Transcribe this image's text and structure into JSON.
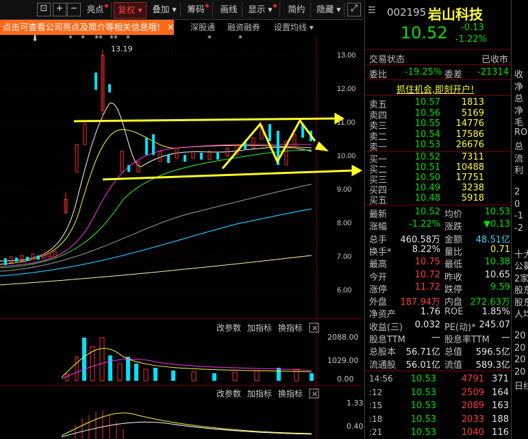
{
  "toolbar": {
    "buttons": [
      "亮点",
      "复权",
      "叠加",
      "筹码",
      "画线",
      "显示",
      "简约",
      "隐藏"
    ],
    "active": "复权"
  },
  "promo": {
    "text": "点击可查看公司亮点及简介等相关信息哦!",
    "close": "✕"
  },
  "sub_links": [
    "深股通",
    "融资融券",
    "设置均线"
  ],
  "chart": {
    "price_axis": [
      "13.00",
      "12.00",
      "11.00",
      "10.00",
      "9.00",
      "8.00",
      "7.00",
      "6.00"
    ],
    "high_label": "13.19",
    "vol_axis": [
      "2088.00",
      "1029.00",
      "0.00"
    ],
    "macd_axis": [
      "1.33",
      "0.40"
    ],
    "panel_buttons": [
      "改参数",
      "加指标",
      "换指标"
    ]
  },
  "stock": {
    "code": "002195",
    "name": "岩山科技",
    "price": "10.52",
    "change": "-0.13",
    "change_pct": "-1.22%"
  },
  "status": {
    "label": "交易状态",
    "value": "已收市"
  },
  "weibi": {
    "label1": "委比",
    "value1": "-19.25%",
    "label2": "委差",
    "value2": "-21314"
  },
  "promo_link": "抓住机会,即刻开户!",
  "sell": [
    {
      "label": "卖五",
      "price": "10.57",
      "vol": "1813"
    },
    {
      "label": "卖四",
      "price": "10.56",
      "vol": "5169"
    },
    {
      "label": "卖三",
      "price": "10.55",
      "vol": "14776"
    },
    {
      "label": "卖二",
      "price": "10.54",
      "vol": "17586"
    },
    {
      "label": "卖一",
      "price": "10.53",
      "vol": "26676"
    }
  ],
  "buy": [
    {
      "label": "买一",
      "price": "10.52",
      "vol": "7311"
    },
    {
      "label": "买二",
      "price": "10.51",
      "vol": "10488"
    },
    {
      "label": "买三",
      "price": "10.50",
      "vol": "17751"
    },
    {
      "label": "买四",
      "price": "10.49",
      "vol": "3238"
    },
    {
      "label": "买五",
      "price": "10.48",
      "vol": "5918"
    }
  ],
  "stats": [
    {
      "l1": "最新",
      "v1": "10.52",
      "c1": "green",
      "l2": "均价",
      "v2": "10.53",
      "c2": "green"
    },
    {
      "l1": "涨幅",
      "v1": "-1.22%",
      "c1": "green",
      "l2": "涨跌",
      "v2": "▼0.13",
      "c2": "green"
    },
    {
      "l1": "总手",
      "v1": "460.58万",
      "c1": "white",
      "l2": "金额",
      "v2": "48.51亿",
      "c2": "cyan"
    },
    {
      "l1": "换手*",
      "v1": "8.22%",
      "c1": "white",
      "l2": "量比",
      "v2": "0.71",
      "c2": "yellow"
    },
    {
      "l1": "最高",
      "v1": "10.75",
      "c1": "red",
      "l2": "最低",
      "v2": "10.38",
      "c2": "green"
    },
    {
      "l1": "今开",
      "v1": "10.72",
      "c1": "red",
      "l2": "昨收",
      "v2": "10.65",
      "c2": "white"
    },
    {
      "l1": "涨停",
      "v1": "11.72",
      "c1": "red",
      "l2": "跌停",
      "v2": "9.59",
      "c2": "green"
    },
    {
      "l1": "外盘",
      "v1": "187.94万",
      "c1": "red",
      "l2": "内盘",
      "v2": "272.63万",
      "c2": "green"
    },
    {
      "l1": "净资产",
      "v1": "1.76",
      "c1": "white",
      "l2": "ROE",
      "v2": "1.85%",
      "c2": "white"
    },
    {
      "l1": "收益(三)",
      "v1": "0.032",
      "c1": "white",
      "l2": "PE(动)*",
      "v2": "245.07",
      "c2": "white"
    },
    {
      "l1": "股息TTM",
      "v1": "—",
      "c1": "white",
      "l2": "股息率TTM",
      "v2": "—",
      "c2": "white"
    },
    {
      "l1": "总股本",
      "v1": "56.71亿",
      "c1": "white",
      "l2": "总值",
      "v2": "596.5亿",
      "c2": "white"
    },
    {
      "l1": "流通股",
      "v1": "56.01亿",
      "c1": "white",
      "l2": "流值",
      "v2": "589.3亿",
      "c2": "white"
    }
  ],
  "ticks": [
    {
      "time": "14:56",
      "price": "10.53",
      "vol": "4791",
      "n": "371"
    },
    {
      "time": ":12",
      "price": "10.53",
      "vol": "2509",
      "n": "164"
    },
    {
      "time": ":15",
      "price": "10.53",
      "vol": "2089",
      "n": "163"
    },
    {
      "time": ":18",
      "price": "10.53",
      "vol": "2033",
      "n": "188"
    },
    {
      "time": ":21",
      "price": "10.53",
      "vol": "1040",
      "n": "116"
    }
  ],
  "far": [
    "收",
    "净",
    "总",
    "净",
    "毛",
    "ROE",
    "总",
    "流",
    "利",
    "",
    "2",
    "0",
    "-1",
    "-2",
    "",
    "十大",
    "公募",
    "2家",
    "股东",
    "股东",
    "人均",
    "",
    "20",
    "20",
    "20",
    "20",
    "日线",
    "",
    "",
    "",
    "",
    ""
  ]
}
